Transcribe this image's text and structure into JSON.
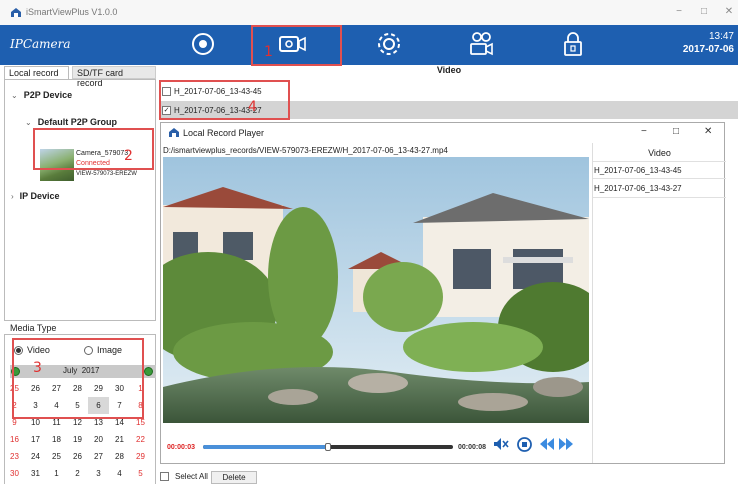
{
  "app": {
    "title": "iSmartViewPlus  V1.0.0"
  },
  "toolbar": {
    "logo": "IPCamera",
    "time": "13:47",
    "date": "2017-07-06",
    "buttons": [
      "eye-icon",
      "video-record-icon",
      "gear-icon",
      "person-camera-icon",
      "lock-icon"
    ]
  },
  "left": {
    "tabs": [
      "Local record",
      "SD/TF card record"
    ],
    "tree": {
      "p2p_device": "P2P Device",
      "group": "Default P2P Group",
      "camera": {
        "name": "Camera_579073",
        "status": "Connected",
        "id": "VIEW-579073-EREZW"
      },
      "ip_device": "IP Device"
    },
    "media_type": {
      "label": "Media Type",
      "options": [
        "Video",
        "Image"
      ],
      "selected": "Video"
    }
  },
  "calendar": {
    "month": "July",
    "year": "2017",
    "selected_day": "6",
    "days": [
      [
        "25",
        "26",
        "27",
        "28",
        "29",
        "30",
        "1"
      ],
      [
        "2",
        "3",
        "4",
        "5",
        "6",
        "7",
        "8"
      ],
      [
        "9",
        "10",
        "11",
        "12",
        "13",
        "14",
        "15"
      ],
      [
        "16",
        "17",
        "18",
        "19",
        "20",
        "21",
        "22"
      ],
      [
        "23",
        "24",
        "25",
        "26",
        "27",
        "28",
        "29"
      ],
      [
        "30",
        "31",
        "1",
        "2",
        "3",
        "4",
        "5"
      ]
    ],
    "weekend_color": "#e03030"
  },
  "main": {
    "header": "Video",
    "files": [
      {
        "name": "H_2017-07-06_13-43-45",
        "checked": false
      },
      {
        "name": "H_2017-07-06_13-43-27",
        "checked": true
      }
    ]
  },
  "player": {
    "title": "Local Record Player",
    "path": "D:/ismartviewplus_records/VIEW-579073-EREZW/H_2017-07-06_13-43-27.mp4",
    "time_current": "00:00:03",
    "time_total": "00:00:08",
    "progress": 0.5,
    "list_header": "Video",
    "list": [
      "H_2017-07-06_13-43-45",
      "H_2017-07-06_13-43-27"
    ]
  },
  "bottom": {
    "select_all": "Select All",
    "delete": "Delete"
  },
  "annotations": {
    "n1": "1",
    "n2": "2",
    "n3": "3",
    "n4": "4"
  },
  "colors": {
    "toolbar": "#1e5fb0",
    "accent": "#4a90d9",
    "highlight": "#e03030"
  }
}
